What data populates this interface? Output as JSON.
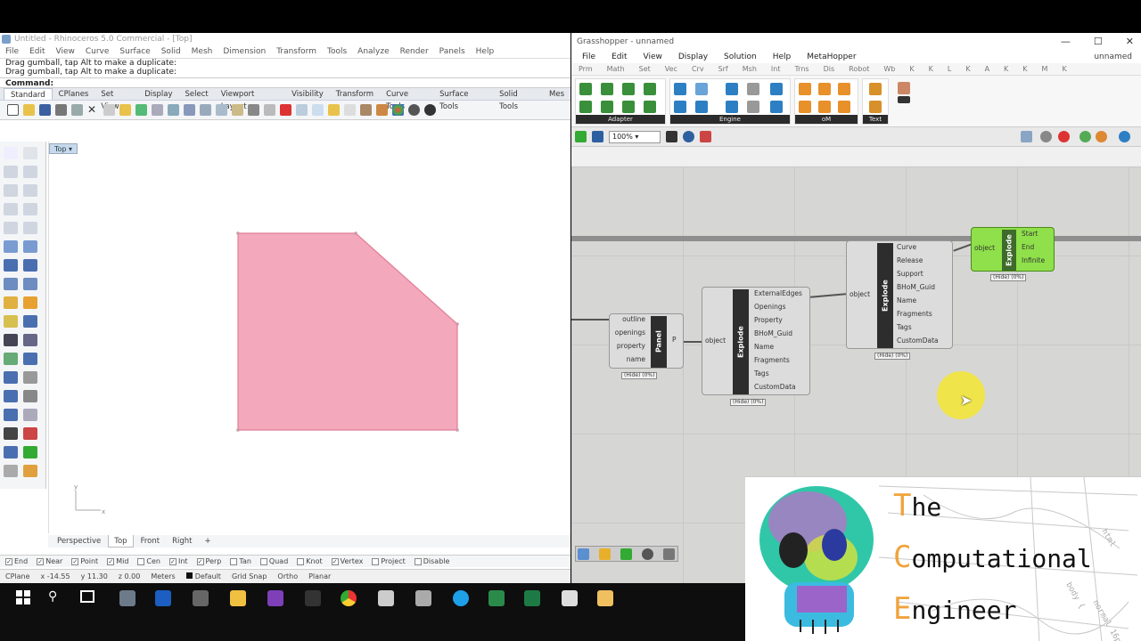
{
  "rhino": {
    "title": "Untitled - Rhinoceros 5.0 Commercial - [Top]",
    "menu": [
      "File",
      "Edit",
      "View",
      "Curve",
      "Surface",
      "Solid",
      "Mesh",
      "Dimension",
      "Transform",
      "Tools",
      "Analyze",
      "Render",
      "Panels",
      "Help"
    ],
    "history": [
      "Drag gumball, tap Alt to make a duplicate:",
      "Drag gumball, tap Alt to make a duplicate:"
    ],
    "command_label": "Command:",
    "toolbar_tabs": [
      "Standard",
      "CPlanes",
      "Set View",
      "Display",
      "Select",
      "Viewport Layout",
      "Visibility",
      "Transform",
      "Curve Tools",
      "Surface Tools",
      "Solid Tools",
      "Mes"
    ],
    "viewport_label": "Top",
    "view_tabs": [
      "Perspective",
      "Top",
      "Front",
      "Right",
      "+"
    ],
    "osnaps": [
      {
        "label": "End",
        "checked": true
      },
      {
        "label": "Near",
        "checked": true
      },
      {
        "label": "Point",
        "checked": true
      },
      {
        "label": "Mid",
        "checked": true
      },
      {
        "label": "Cen",
        "checked": false
      },
      {
        "label": "Int",
        "checked": true
      },
      {
        "label": "Perp",
        "checked": true
      },
      {
        "label": "Tan",
        "checked": false
      },
      {
        "label": "Quad",
        "checked": false
      },
      {
        "label": "Knot",
        "checked": false
      },
      {
        "label": "Vertex",
        "checked": true
      },
      {
        "label": "Project",
        "checked": false
      },
      {
        "label": "Disable",
        "checked": false
      }
    ],
    "status": {
      "cplane": "CPlane",
      "x": "x -14.55",
      "y": "y 11.30",
      "z": "z 0.00",
      "units": "Meters",
      "layer": "Default",
      "grid_snap": "Grid Snap",
      "ortho": "Ortho",
      "planar": "Planar"
    },
    "shape_color": "#f4a8bb"
  },
  "grasshopper": {
    "title": "Grasshopper - unnamed",
    "window_controls": [
      "—",
      "☐",
      "✕"
    ],
    "menu": [
      "File",
      "Edit",
      "View",
      "Display",
      "Solution",
      "Help",
      "MetaHopper"
    ],
    "doc_name": "unnamed",
    "categories": [
      "Prm",
      "Math",
      "Set",
      "Vec",
      "Crv",
      "Srf",
      "Msh",
      "Int",
      "Trns",
      "Dis",
      "Robot",
      "Wb",
      "K",
      "K",
      "L",
      "K",
      "A",
      "K",
      "K",
      "M",
      "K",
      "K",
      "K"
    ],
    "panel_groups": [
      "Adapter",
      "Engine",
      "oM",
      "Text"
    ],
    "zoom": "100%",
    "panel_comp": {
      "title": "Panel",
      "inputs": [
        "outline",
        "openings",
        "property",
        "name"
      ],
      "output": "P",
      "tag": "(Hide)  (0%)"
    },
    "explode1": {
      "title": "Explode",
      "input": "object",
      "outputs": [
        "ExternalEdges",
        "Openings",
        "Property",
        "BHoM_Guid",
        "Name",
        "Fragments",
        "Tags",
        "CustomData"
      ],
      "tag": "(Hide)  (0%)"
    },
    "explode2": {
      "title": "Explode",
      "input": "object",
      "outputs": [
        "Curve",
        "Release",
        "Support",
        "BHoM_Guid",
        "Name",
        "Fragments",
        "Tags",
        "CustomData"
      ],
      "tag": "(Hide)  (0%)"
    },
    "explode3": {
      "title": "Explode",
      "input": "object",
      "outputs": [
        "Start",
        "End",
        "Infinite"
      ],
      "tag": "(Hide)  (0%)"
    }
  },
  "logo": {
    "lines": [
      [
        "T",
        "he"
      ],
      [
        "C",
        "omputational"
      ],
      [
        "E",
        "ngineer"
      ]
    ]
  }
}
